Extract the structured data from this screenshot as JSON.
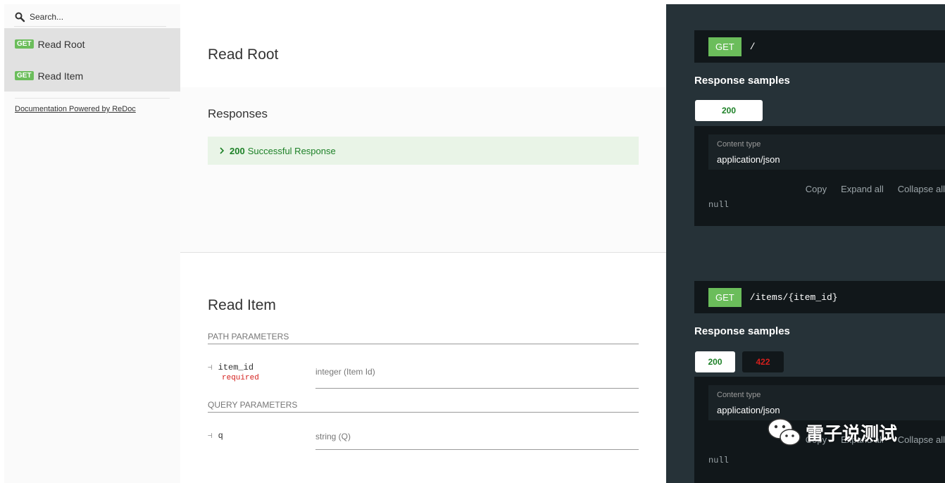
{
  "sidebar": {
    "search_placeholder": "Search...",
    "items": [
      {
        "method": "GET",
        "label": "Read Root"
      },
      {
        "method": "GET",
        "label": "Read Item"
      }
    ],
    "powered_by": "Documentation Powered by ReDoc"
  },
  "read_root": {
    "title": "Read Root",
    "responses_heading": "Responses",
    "response": {
      "code": "200",
      "description": "Successful Response"
    }
  },
  "read_item": {
    "title": "Read Item",
    "path_params_heading": "PATH PARAMETERS",
    "path_param": {
      "name": "item_id",
      "required": "required",
      "type": "integer (Item Id)"
    },
    "query_params_heading": "QUERY PARAMETERS",
    "query_param": {
      "name": "q",
      "type": "string (Q)"
    }
  },
  "right_panel": {
    "endpoint1": {
      "method": "GET",
      "path": "/"
    },
    "endpoint2": {
      "method": "GET",
      "path": "/items/{item_id}"
    },
    "response_samples_title": "Response samples",
    "tabs1": [
      "200"
    ],
    "tabs2": [
      "200",
      "422"
    ],
    "content_type_label": "Content type",
    "content_type_value": "application/json",
    "actions": [
      "Copy",
      "Expand all",
      "Collapse all"
    ],
    "null_value": "null"
  },
  "watermark": {
    "text": "雷子说测试"
  },
  "colors": {
    "get_badge": "#6bbd5b",
    "success_text": "#1d8127",
    "error_text": "#d41f1c",
    "dark_panel": "#263238"
  }
}
